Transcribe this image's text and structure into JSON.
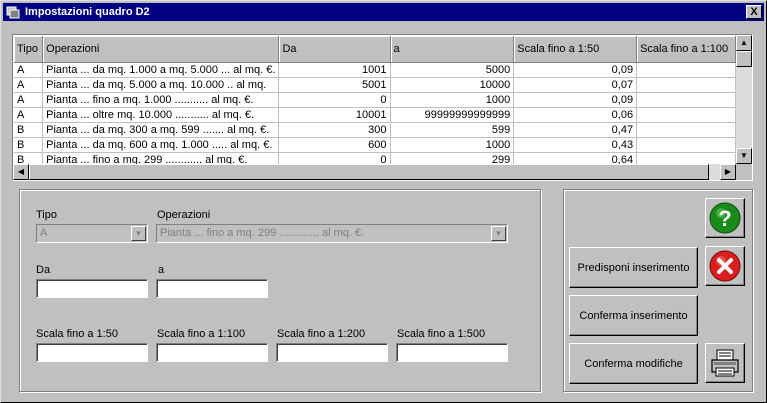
{
  "window": {
    "title": "Impostazioni quadro D2",
    "close_label": "X"
  },
  "grid": {
    "columns": [
      "Tipo",
      "Operazioni",
      "Da",
      "a",
      "Scala fino a 1:50",
      "Scala fino a 1:100"
    ],
    "rows": [
      [
        "A",
        "Pianta ... da mq. 1.000 a mq. 5.000 ... al mq. €.",
        "1001",
        "5000",
        "0,09",
        ""
      ],
      [
        "A",
        "Pianta ... da mq. 5.000 a mq. 10.000 .. al mq.",
        "5001",
        "10000",
        "0,07",
        ""
      ],
      [
        "A",
        "Pianta ... fino a mq. 1.000 ........... al mq. €.",
        "0",
        "1000",
        "0,09",
        ""
      ],
      [
        "A",
        "Pianta ... oltre mq. 10.000 ........... al mq. €.",
        "10001",
        "99999999999999",
        "0,06",
        ""
      ],
      [
        "B",
        "Pianta ... da mq. 300 a mq. 599 ....... al mq. €.",
        "300",
        "599",
        "0,47",
        ""
      ],
      [
        "B",
        "Pianta ... da mq. 600 a mq. 1.000 ..... al mq. €.",
        "600",
        "1000",
        "0,43",
        ""
      ],
      [
        "B",
        "Pianta ... fino a mq. 299 ............ al mq. €.",
        "0",
        "299",
        "0,64",
        ""
      ]
    ]
  },
  "form": {
    "tipo_label": "Tipo",
    "tipo_value": "A",
    "operazioni_label": "Operazioni",
    "operazioni_value": "Pianta ... fino a mq. 299 ............. al mq. €.",
    "da_label": "Da",
    "a_label": "a",
    "scala50_label": "Scala fino a 1:50",
    "scala100_label": "Scala fino a 1:100",
    "scala200_label": "Scala fino a 1:200",
    "scala500_label": "Scala fino a 1:500"
  },
  "buttons": {
    "predisponi": "Predisponi inserimento",
    "conferma_ins": "Conferma inserimento",
    "conferma_mod": "Conferma modifiche"
  },
  "icons": {
    "help": "help-icon",
    "cancel": "cancel-icon",
    "print": "printer-icon"
  },
  "colors": {
    "titlebar": "#000080",
    "help_green": "#1a8a1a",
    "cancel_red": "#d81e1e"
  }
}
